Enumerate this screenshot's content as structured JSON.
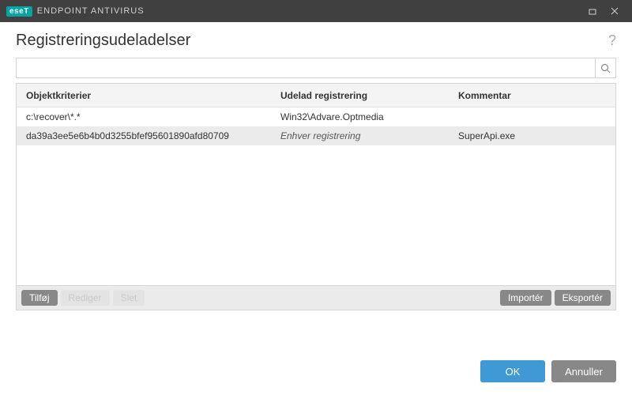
{
  "titlebar": {
    "brand_badge": "eseT",
    "brand_text": "ENDPOINT ANTIVIRUS"
  },
  "header": {
    "title": "Registreringsudeladelser",
    "help_tooltip": "?"
  },
  "search": {
    "value": "",
    "placeholder": ""
  },
  "table": {
    "columns": {
      "object": "Objektkriterier",
      "exclude": "Udelad registrering",
      "comment": "Kommentar"
    },
    "rows": [
      {
        "object": "c:\\recover\\*.*",
        "exclude": "Win32\\Advare.Optmedia",
        "exclude_italic": false,
        "comment": "",
        "selected": false
      },
      {
        "object": "da39a3ee5e6b4b0d3255bfef95601890afd80709",
        "exclude": "Enhver registrering",
        "exclude_italic": true,
        "comment": "SuperApi.exe",
        "selected": true
      }
    ]
  },
  "actions": {
    "add": "Tilføj",
    "edit": "Rediger",
    "delete": "Slet",
    "import": "Importér",
    "export": "Eksportér"
  },
  "footer": {
    "ok": "OK",
    "cancel": "Annuller"
  }
}
